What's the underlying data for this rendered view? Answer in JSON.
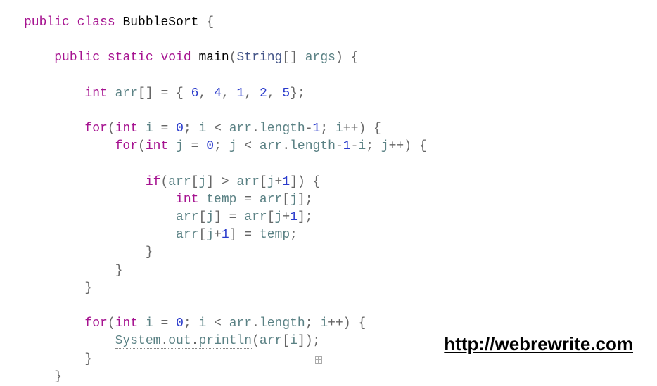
{
  "code": {
    "l1": {
      "kw1": "public",
      "kw2": "class",
      "cls": "BubbleSort",
      "brace": " {"
    },
    "l3": {
      "kw1": "public",
      "kw2": "static",
      "kw3": "void",
      "meth": "main",
      "p1": "(",
      "stype": "String",
      "arr": "[]",
      "arg": " args",
      "p2": ") {"
    },
    "l5": {
      "type": "int",
      "var": " arr",
      "rest1": "[] = { ",
      "n1": "6",
      "c1": ", ",
      "n2": "4",
      "c2": ", ",
      "n3": "1",
      "c3": ", ",
      "n4": "2",
      "c4": ", ",
      "n5": "5",
      "rest2": "};"
    },
    "l7": {
      "kw": "for",
      "p1": "(",
      "type": "int",
      "var": " i",
      "eq": " = ",
      "zero": "0",
      "semi1": "; ",
      "ivar": "i",
      "lt": " < ",
      "arr": "arr",
      "dot": ".",
      "len": "length",
      "m1": "-",
      "one": "1",
      "semi2": "; ",
      "ipp": "i",
      "pp": "++) {"
    },
    "l8": {
      "kw": "for",
      "p1": "(",
      "type": "int",
      "var": " j",
      "eq": " = ",
      "zero": "0",
      "semi1": "; ",
      "jvar": "j",
      "lt": " < ",
      "arr": "arr",
      "dot": ".",
      "len": "length",
      "m1": "-",
      "one": "1",
      "m2": "-",
      "ivar": "i",
      "semi2": "; ",
      "jpp": "j",
      "pp": "++) {"
    },
    "l10": {
      "kw": "if",
      "p1": "(",
      "arr1": "arr",
      "b1": "[",
      "j1": "j",
      "b2": "] > ",
      "arr2": "arr",
      "b3": "[",
      "j2": "j",
      "plus": "+",
      "one": "1",
      "b4": "]) {"
    },
    "l11": {
      "type": "int",
      "temp": " temp",
      "eq": " = ",
      "arr": "arr",
      "b1": "[",
      "j": "j",
      "b2": "];"
    },
    "l12": {
      "arr1": "arr",
      "b1": "[",
      "j1": "j",
      "b2": "] = ",
      "arr2": "arr",
      "b3": "[",
      "j2": "j",
      "plus": "+",
      "one": "1",
      "b4": "];"
    },
    "l13": {
      "arr": "arr",
      "b1": "[",
      "j": "j",
      "plus": "+",
      "one": "1",
      "b2": "] = ",
      "temp": "temp",
      "semi": ";"
    },
    "l14": "}",
    "l15": "}",
    "l16": "}",
    "l18": {
      "kw": "for",
      "p1": "(",
      "type": "int",
      "var": " i",
      "eq": " = ",
      "zero": "0",
      "semi1": "; ",
      "ivar": "i",
      "lt": " < ",
      "arr": "arr",
      "dot": ".",
      "len": "length",
      "semi2": "; ",
      "ipp": "i",
      "pp": "++) {"
    },
    "l19": {
      "sys": "System",
      "d1": ".",
      "out": "out",
      "d2": ".",
      "pln": "println",
      "p1": "(",
      "arr": "arr",
      "b1": "[",
      "i": "i",
      "b2": "]);"
    },
    "l20": "}",
    "l21": "}"
  },
  "url": "http://webrewrite.com"
}
